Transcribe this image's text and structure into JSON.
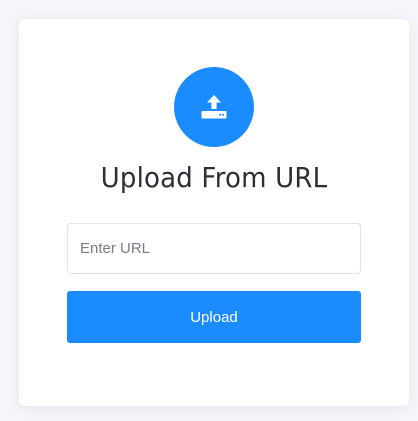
{
  "upload_card": {
    "icon": "upload-icon",
    "title": "Upload From URL",
    "url_input": {
      "value": "",
      "placeholder": "Enter URL"
    },
    "upload_button_label": "Upload"
  },
  "colors": {
    "accent": "#1a8cff",
    "title_text": "#2a2f38",
    "placeholder_text": "#777c86",
    "page_background": "#f5f6fa"
  }
}
